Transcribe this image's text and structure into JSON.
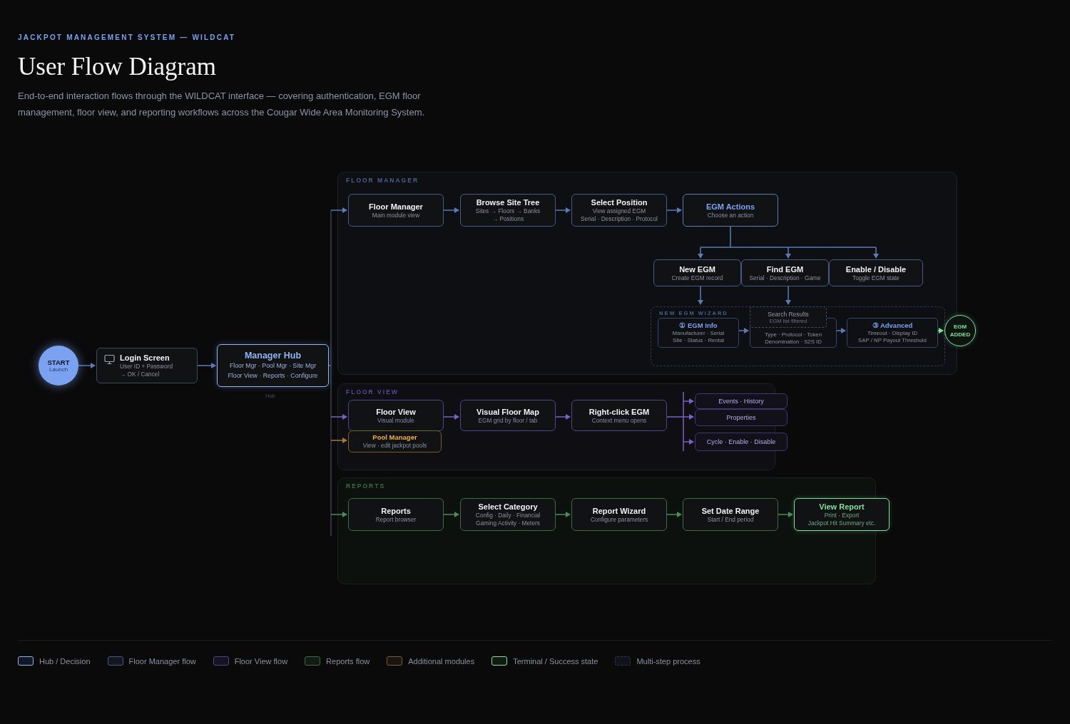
{
  "header": {
    "eyebrow": "JACKPOT MANAGEMENT SYSTEM — WILDCAT",
    "title": "User Flow Diagram",
    "description": "End-to-end interaction flows through the WILDCAT interface — covering authentication, EGM floor management, floor view, and reporting workflows across the Cougar Wide Area Monitoring System."
  },
  "start": {
    "title": "START",
    "subtitle": "Launch"
  },
  "hub_caption": "Hub",
  "sections": [
    {
      "kind": "floor_manager",
      "label": "FLOOR MANAGER"
    },
    {
      "kind": "floor_view",
      "label": "FLOOR VIEW"
    },
    {
      "kind": "reports",
      "label": "REPORTS"
    }
  ],
  "nodes": [
    {
      "kind": "login",
      "title": "Login Screen",
      "lines": [
        "User ID + Password",
        "→ OK / Cancel"
      ]
    },
    {
      "kind": "hub",
      "title": "Manager Hub",
      "lines": [
        "Floor Mgr · Pool Mgr · Site Mgr",
        "Floor View · Reports · Configure"
      ]
    },
    {
      "kind": "fm",
      "title": "Floor Manager",
      "lines": [
        "Main module view"
      ]
    },
    {
      "kind": "fm",
      "title": "Browse Site Tree",
      "lines": [
        "Sites → Floors → Banks",
        "→ Positions"
      ]
    },
    {
      "kind": "fm",
      "title": "Select Position",
      "lines": [
        "View assigned EGM",
        "Serial · Description · Protocol"
      ]
    },
    {
      "kind": "decision",
      "title": "EGM Actions",
      "lines": [
        "Choose an action"
      ]
    },
    {
      "kind": "fm",
      "title": "New EGM",
      "lines": [
        "Create EGM record"
      ]
    },
    {
      "kind": "fm",
      "title": "Find EGM",
      "lines": [
        "Serial · Description · Game"
      ]
    },
    {
      "kind": "fm",
      "title": "Enable / Disable",
      "lines": [
        "Toggle EGM state"
      ]
    },
    {
      "kind": "fv",
      "title": "Floor View",
      "lines": [
        "Visual module"
      ]
    },
    {
      "kind": "fv",
      "title": "Visual Floor Map",
      "lines": [
        "EGM grid by floor / tab"
      ]
    },
    {
      "kind": "fv",
      "title": "Right-click EGM",
      "lines": [
        "Context menu opens"
      ]
    },
    {
      "kind": "additional",
      "title": "Pool Manager",
      "lines": [
        "View · edit jackpot pools"
      ]
    },
    {
      "kind": "menu",
      "title": "Events · History"
    },
    {
      "kind": "menu",
      "title": "Properties"
    },
    {
      "kind": "menu",
      "title": "Cycle · Enable · Disable"
    },
    {
      "kind": "reports",
      "title": "Reports",
      "lines": [
        "Report browser"
      ]
    },
    {
      "kind": "reports",
      "title": "Select Category",
      "lines": [
        "Config · Daily · Financial",
        "Gaming Activity · Meters"
      ]
    },
    {
      "kind": "reports",
      "title": "Report Wizard",
      "lines": [
        "Configure parameters"
      ]
    },
    {
      "kind": "reports",
      "title": "Set Date Range",
      "lines": [
        "Start / End period"
      ]
    },
    {
      "kind": "terminal",
      "title": "View Report",
      "lines": [
        "Print · Export",
        "Jackpot Hit Summary etc."
      ]
    }
  ],
  "wizard": {
    "label": "NEW EGM WIZARD",
    "steps": [
      {
        "title": "① EGM Info",
        "lines": [
          "Manufacturer · Serial",
          "Site · Status · Rental"
        ]
      },
      {
        "lines": [
          "Type · Protocol · Token",
          "Denomination · S2S ID"
        ]
      },
      {
        "title": "③ Advanced",
        "lines": [
          "Timeout · Display ID",
          "SAP / NP Payout Threshold"
        ]
      }
    ]
  },
  "popup": {
    "title": "Search Results",
    "subtitle": "EGM list filtered"
  },
  "end": {
    "lines": [
      "EGM",
      "ADDED"
    ]
  },
  "legend": [
    {
      "kind": "hub",
      "label": "Hub / Decision"
    },
    {
      "kind": "fm",
      "label": "Floor Manager flow"
    },
    {
      "kind": "fv",
      "label": "Floor View flow"
    },
    {
      "kind": "reports",
      "label": "Reports flow"
    },
    {
      "kind": "additional",
      "label": "Additional modules"
    },
    {
      "kind": "terminal",
      "label": "Terminal / Success state"
    },
    {
      "kind": "multistep",
      "label": "Multi-step process"
    }
  ]
}
